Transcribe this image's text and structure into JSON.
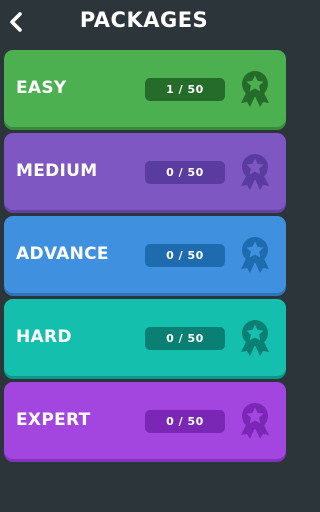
{
  "header": {
    "title": "PACKAGES",
    "back_icon": "chevron-left-icon"
  },
  "packages": [
    {
      "label": "EASY",
      "progress": "1 / 50",
      "color": "#4caf50",
      "shadow": "#3a8a3d",
      "pill": "#256b2a",
      "medal_color": "#256b2a",
      "icon": "medal-icon"
    },
    {
      "label": "MEDIUM",
      "progress": "0 / 50",
      "color": "#7e57c2",
      "shadow": "#6442a3",
      "pill": "#5a3ca0",
      "medal_color": "#5a3ca0",
      "icon": "medal-icon"
    },
    {
      "label": "ADVANCE",
      "progress": "0 / 50",
      "color": "#3f91df",
      "shadow": "#2f74b8",
      "pill": "#1f6bb0",
      "medal_color": "#1f6bb0",
      "icon": "medal-icon"
    },
    {
      "label": "HARD",
      "progress": "0 / 50",
      "color": "#14bfae",
      "shadow": "#0e9688",
      "pill": "#0a7f73",
      "medal_color": "#0a7f73",
      "icon": "medal-icon"
    },
    {
      "label": "EXPERT",
      "progress": "0 / 50",
      "color": "#a346e0",
      "shadow": "#8233bb",
      "pill": "#7a27b5",
      "medal_color": "#7a27b5",
      "icon": "medal-icon"
    }
  ]
}
